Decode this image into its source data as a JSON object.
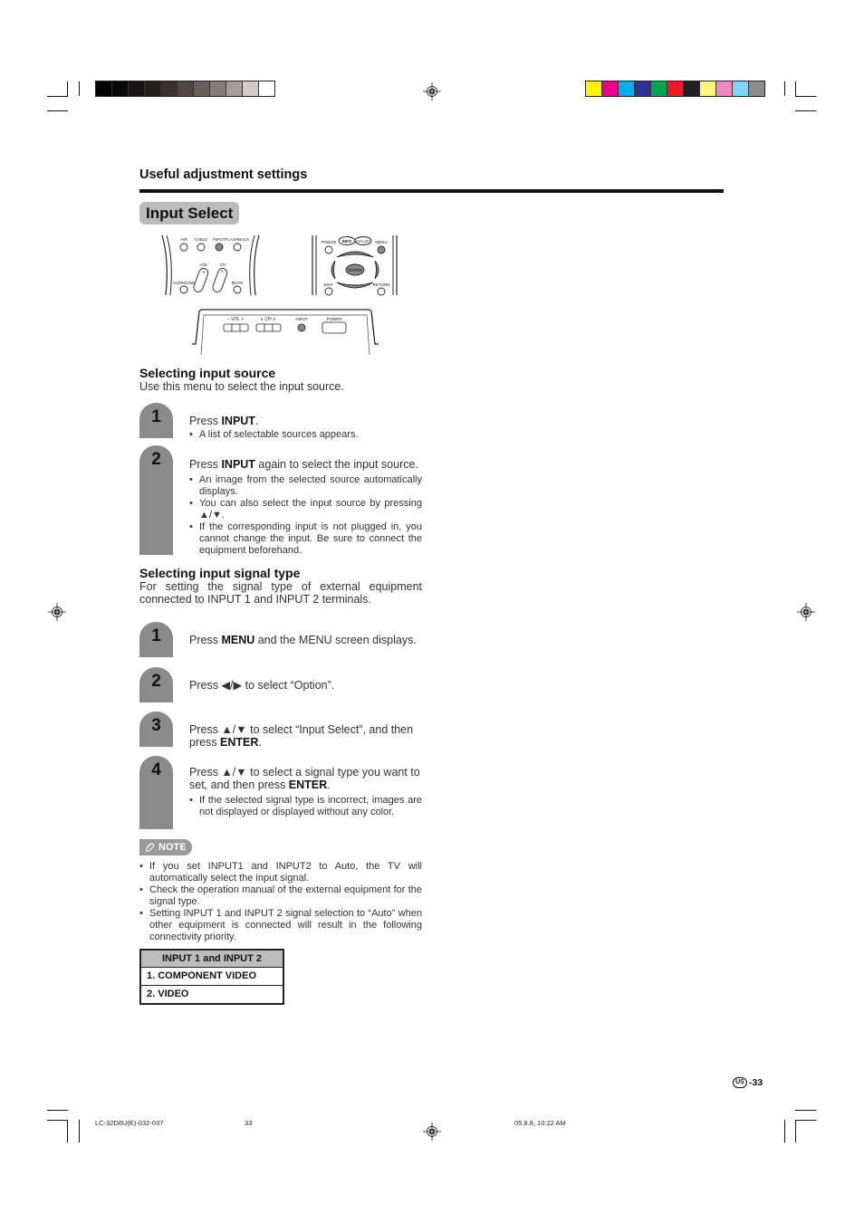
{
  "print_marks": {
    "grayscale_swatches": [
      "#000000",
      "#0b0908",
      "#181413",
      "#231f1c",
      "#3a302e",
      "#514645",
      "#6a5e5b",
      "#857b79",
      "#a69c9a",
      "#d5cac9",
      "#ffffff"
    ],
    "color_swatches": [
      "#fff200",
      "#ec008c",
      "#00aeef",
      "#2e3192",
      "#00a651",
      "#ed1c24",
      "#231f20",
      "#fff57a",
      "#f287c0",
      "#7fd4f7",
      "#8c8c8c"
    ]
  },
  "header": {
    "section_label": "Useful adjustment settings",
    "page_title": "Input Select"
  },
  "illustrations": {
    "remote_left": {
      "buttons": [
        "AIR",
        "CABLE",
        "INPUT",
        "FLASHBACK",
        "VOL",
        "CH",
        "SURROUND",
        "MUTE"
      ]
    },
    "remote_right": {
      "buttons": [
        "FREEZE",
        "INFO",
        "CH LIST",
        "MENU",
        "ENTER",
        "EXIT",
        "RETURN"
      ]
    },
    "tv_panel": {
      "buttons": [
        "– VOL +",
        "∨ CH ∧",
        "INPUT",
        "POWER"
      ]
    }
  },
  "selecting_source": {
    "heading": "Selecting input source",
    "intro": "Use this menu to select the input source.",
    "steps": [
      {
        "number": "1",
        "text_pre": "Press ",
        "text_bold": "INPUT",
        "text_post": ".",
        "bullets": [
          "A list of selectable sources appears."
        ]
      },
      {
        "number": "2",
        "text_pre": "Press ",
        "text_bold": "INPUT",
        "text_post": " again to select the input source.",
        "bullets": [
          "An image from the selected source automatically displays.",
          "You can also select the input source by pressing ▲/▼.",
          "If the corresponding input is not plugged in, you cannot change the input. Be sure to connect the equipment beforehand."
        ]
      }
    ]
  },
  "selecting_signal": {
    "heading": "Selecting input signal type",
    "intro": "For setting the signal type of external equipment connected to INPUT 1 and INPUT 2 terminals.",
    "steps": [
      {
        "number": "1",
        "text_pre": "Press ",
        "text_bold": "MENU",
        "text_post": " and the MENU screen displays."
      },
      {
        "number": "2",
        "text_pre": "Press ◀/▶ to select “Option”.",
        "text_bold": "",
        "text_post": ""
      },
      {
        "number": "3",
        "text_pre": "Press ▲/▼ to select “Input Select”, and then press ",
        "text_bold": "ENTER",
        "text_post": "."
      },
      {
        "number": "4",
        "text_pre": "Press ▲/▼ to select a signal type you want to set, and then press ",
        "text_bold": "ENTER",
        "text_post": ".",
        "bullets": [
          "If the selected signal type is incorrect, images are not displayed or displayed without any color."
        ]
      }
    ]
  },
  "note": {
    "label": "NOTE",
    "items": [
      "If you set INPUT1 and INPUT2 to Auto, the TV will automatically select the input signal.",
      "Check the operation manual of the external equipment for the signal type.",
      "Setting INPUT 1 and INPUT 2 signal selection to “Auto” when other equipment is connected will result in the following connectivity priority."
    ]
  },
  "priority_table": {
    "header": "INPUT 1 and INPUT 2",
    "rows": [
      "1. COMPONENT VIDEO",
      "2. VIDEO"
    ]
  },
  "page_number": {
    "region": "US",
    "number": "-33"
  },
  "footer": {
    "file": "LC-32D6U(E)-032-037",
    "page": "33",
    "timestamp": "05.8.8, 10:22 AM"
  }
}
